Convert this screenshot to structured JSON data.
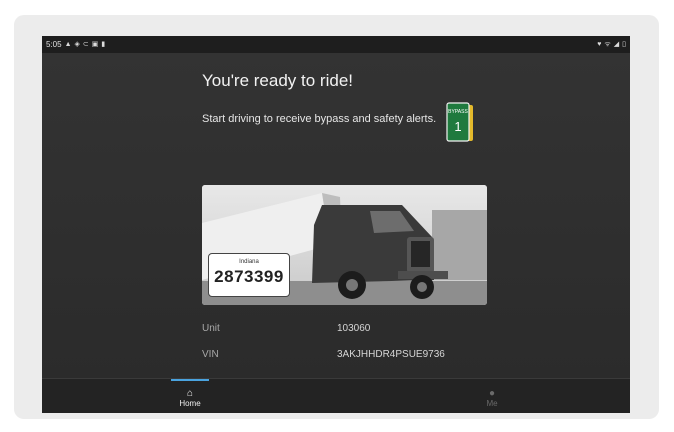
{
  "status_bar": {
    "time": "5:05",
    "left_icons": [
      "image-icon",
      "photo-icon",
      "vpn-icon",
      "message-icon",
      "battery-saver-icon"
    ],
    "right_icons": [
      "location-icon",
      "wifi-icon",
      "signal-icon",
      "battery-icon"
    ]
  },
  "main": {
    "title": "You're ready to ride!",
    "subtitle": "Start driving to receive bypass and safety alerts.",
    "bypass_sign": {
      "text": "BYPASS",
      "number": "1",
      "color": "#1f7a3e"
    },
    "plate": {
      "state": "Indiana",
      "number": "2873399"
    },
    "details": [
      {
        "label": "Unit",
        "value": "103060"
      },
      {
        "label": "VIN",
        "value": "3AKJHHDR4PSUE9736"
      }
    ]
  },
  "bottom_nav": {
    "items": [
      {
        "label": "Home",
        "icon": "home-icon",
        "active": true
      },
      {
        "label": "Me",
        "icon": "person-icon",
        "active": false
      }
    ],
    "accent": "#4aa3df"
  }
}
